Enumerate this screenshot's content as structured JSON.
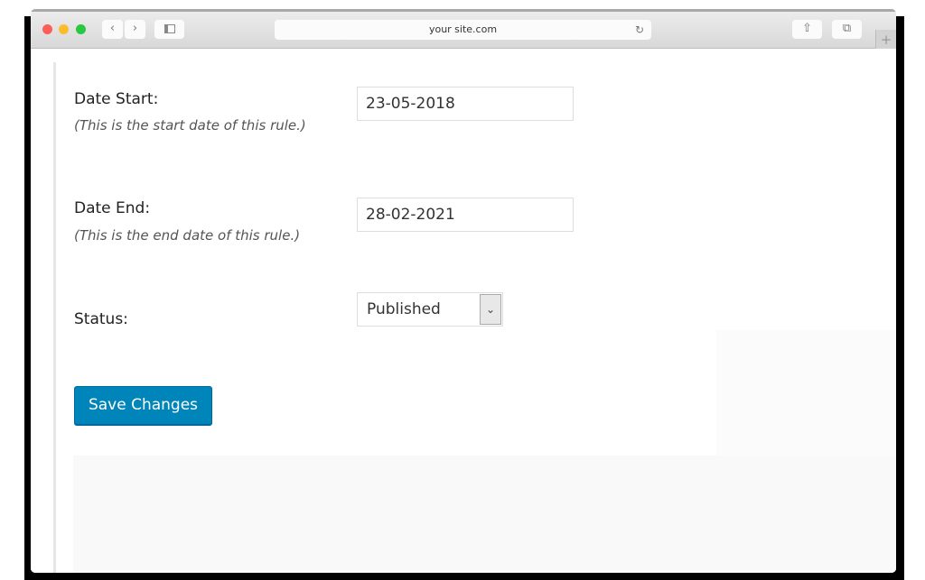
{
  "browser": {
    "url": "your site.com",
    "back": "‹",
    "forward": "›",
    "reload": "↻",
    "plus": "+"
  },
  "form": {
    "date_start": {
      "label": "Date Start:",
      "hint": "(This is the start date of this rule.)",
      "value": "23-05-2018"
    },
    "date_end": {
      "label": "Date End:",
      "hint": "(This is the end date of this rule.)",
      "value": "28-02-2021"
    },
    "status": {
      "label": "Status:",
      "value": "Published"
    },
    "save_label": "Save Changes"
  },
  "colors": {
    "button": "#0085ba"
  }
}
